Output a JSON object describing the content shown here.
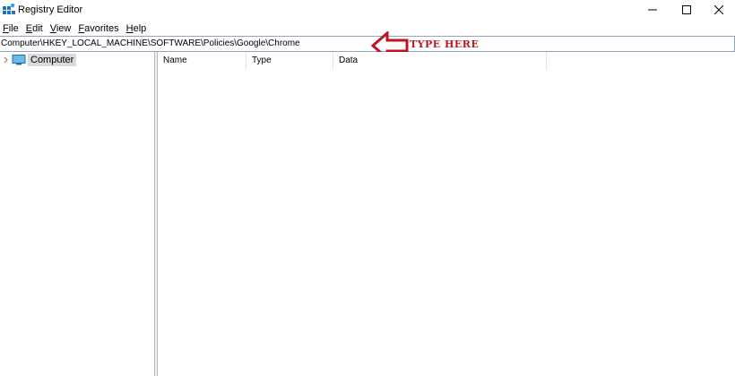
{
  "window": {
    "title": "Registry Editor"
  },
  "menu": {
    "items": [
      {
        "accel": "F",
        "rest": "ile"
      },
      {
        "accel": "E",
        "rest": "dit"
      },
      {
        "accel": "V",
        "rest": "iew"
      },
      {
        "accel": "F",
        "rest": "avorites",
        "prefix": ""
      },
      {
        "accel": "H",
        "rest": "elp"
      }
    ]
  },
  "address": {
    "value": "Computer\\HKEY_LOCAL_MACHINE\\SOFTWARE\\Policies\\Google\\Chrome"
  },
  "annotation": {
    "text": "TYPE HERE",
    "color": "#c0141e"
  },
  "tree": {
    "root_label": "Computer"
  },
  "list": {
    "columns": [
      "Name",
      "Type",
      "Data"
    ]
  },
  "colors": {
    "selection": "#d9d9d9",
    "address_border": "#8fa5c4",
    "icon_blue": "#1e73c8"
  }
}
